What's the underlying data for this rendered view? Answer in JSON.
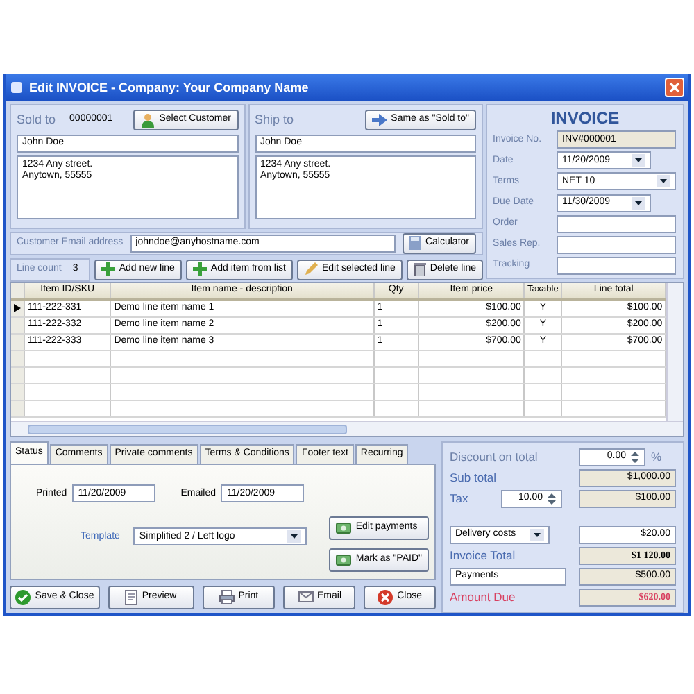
{
  "window": {
    "title": "Edit INVOICE - Company: Your Company Name"
  },
  "sold_to": {
    "label": "Sold to",
    "number": "00000001",
    "button": "Select Customer",
    "name": "John Doe",
    "address": "1234 Any street.\nAnytown, 55555"
  },
  "ship_to": {
    "label": "Ship to",
    "button": "Same as \"Sold to\"",
    "name": "John Doe",
    "address": "1234 Any street.\nAnytown, 55555"
  },
  "invoice": {
    "heading": "INVOICE",
    "fields": [
      {
        "label": "Invoice No.",
        "value": "INV#000001",
        "kind": "readonly"
      },
      {
        "label": "Date",
        "value": "11/20/2009",
        "kind": "date"
      },
      {
        "label": "Terms",
        "value": "NET 10",
        "kind": "select"
      },
      {
        "label": "Due Date",
        "value": "11/30/2009",
        "kind": "date"
      },
      {
        "label": "Order",
        "kind": "text"
      },
      {
        "label": "Sales Rep.",
        "kind": "text"
      },
      {
        "label": "Tracking",
        "kind": "text"
      }
    ]
  },
  "email": {
    "label": "Customer Email address",
    "value": "johndoe@anyhostname.com"
  },
  "calculator_button": "Calculator",
  "line_count": {
    "label": "Line count",
    "value": "3"
  },
  "line_buttons": [
    {
      "label": "Add new line",
      "kind": "add"
    },
    {
      "label": "Add item from list",
      "kind": "add"
    },
    {
      "label": "Edit selected line",
      "kind": "edit"
    },
    {
      "label": "Delete line",
      "kind": "delete"
    }
  ],
  "table": {
    "columns": [
      "Item ID/SKU",
      "Item name - description",
      "Qty",
      "Item price",
      "Taxable",
      "Line total"
    ],
    "rows": [
      {
        "selected": true,
        "cells": [
          "111-222-331",
          "Demo line item name 1",
          "1",
          "$100.00",
          "Y",
          "$100.00"
        ]
      },
      {
        "selected": false,
        "cells": [
          "111-222-332",
          "Demo line item name 2",
          "1",
          "$200.00",
          "Y",
          "$200.00"
        ]
      },
      {
        "selected": false,
        "cells": [
          "111-222-333",
          "Demo line item name 3",
          "1",
          "$700.00",
          "Y",
          "$700.00"
        ]
      }
    ]
  },
  "tabs": [
    {
      "label": "Status",
      "selected": true
    },
    {
      "label": "Comments",
      "selected": false
    },
    {
      "label": "Private comments",
      "selected": false
    },
    {
      "label": "Terms & Conditions",
      "selected": false
    },
    {
      "label": "Footer text",
      "selected": false
    },
    {
      "label": "Recurring",
      "selected": false
    }
  ],
  "status": {
    "printed_label": "Printed",
    "printed": "11/20/2009",
    "emailed_label": "Emailed",
    "emailed": "11/20/2009",
    "template_label": "Template",
    "template": "Simplified 2 / Left logo"
  },
  "payment_buttons": [
    "Edit payments",
    "Mark as \"PAID\""
  ],
  "totals": {
    "discount_label": "Discount on total",
    "discount": "0.00",
    "discount_unit": "%",
    "subtotal_label": "Sub total",
    "subtotal": "$1,000.00",
    "tax_label": "Tax",
    "tax_rate": "10.00",
    "tax": "$100.00",
    "delivery_label": "Delivery costs",
    "delivery": "$20.00",
    "total_label": "Invoice Total",
    "total": "$1 120.00",
    "payments_label": "Payments",
    "payments": "$500.00",
    "due_label": "Amount Due",
    "due": "$620.00"
  },
  "footer_buttons": [
    {
      "label": "Save & Close",
      "kind": "save"
    },
    {
      "label": "Preview",
      "kind": "preview"
    },
    {
      "label": "Print",
      "kind": "print"
    },
    {
      "label": "Email",
      "kind": "email"
    },
    {
      "label": "Close",
      "kind": "close"
    }
  ]
}
